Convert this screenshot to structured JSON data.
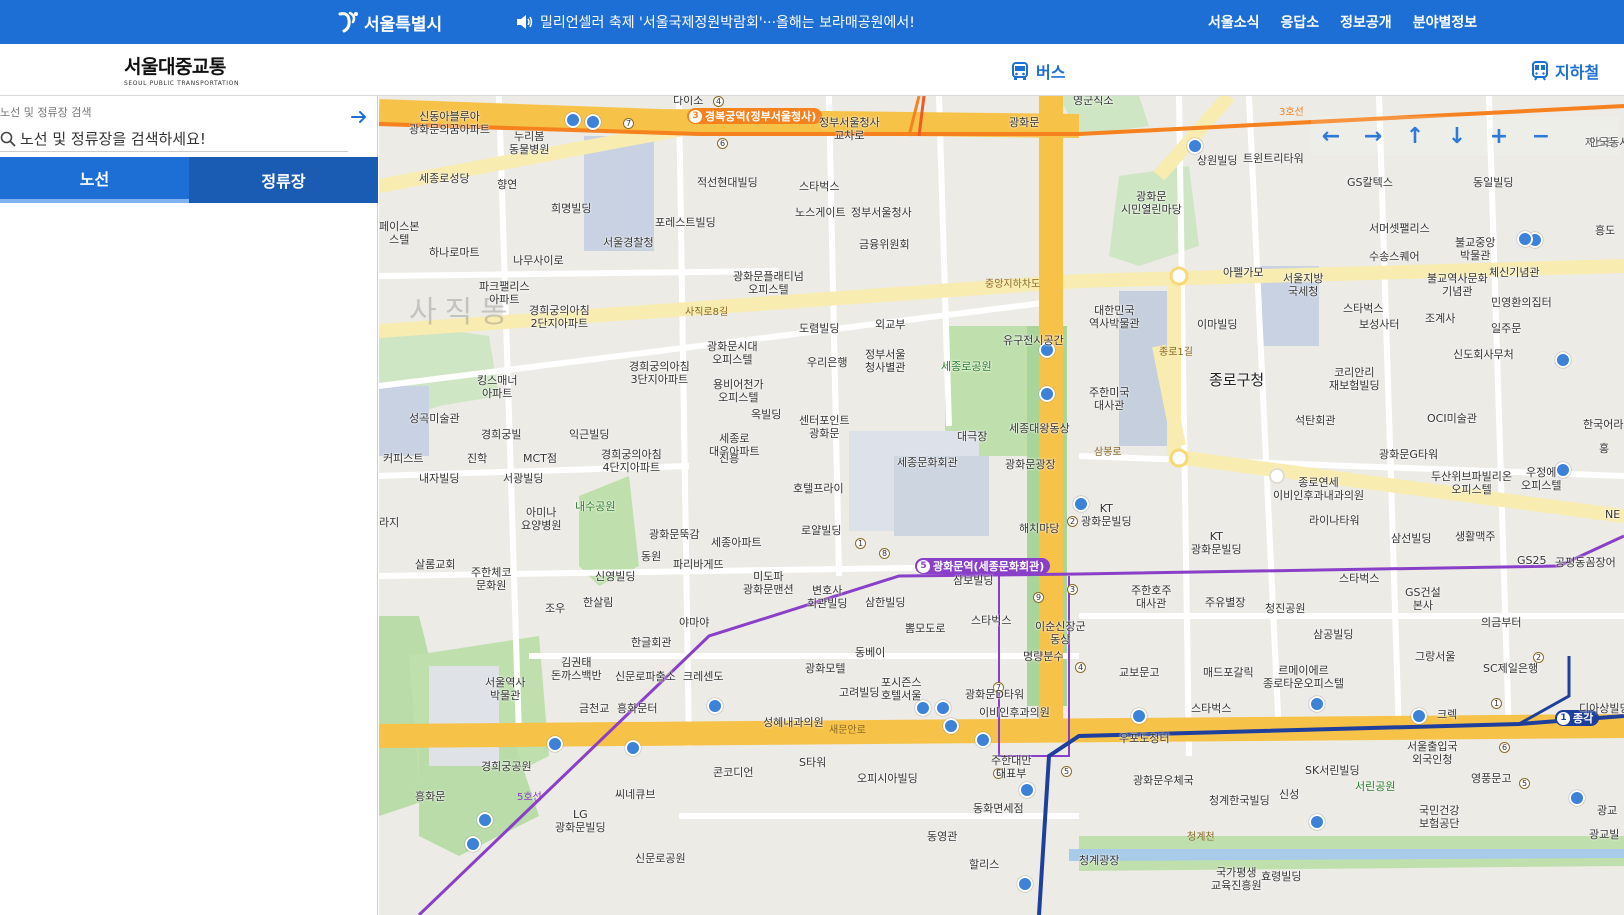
{
  "topbar": {
    "logo_text": "서울특별시",
    "notice": "밀리언셀러 축제 '서울국제정원박람회'···올해는 보라매공원에서!",
    "menu": [
      "서울소식",
      "응답소",
      "정보공개",
      "분야별정보"
    ],
    "bg_color": "#1d6fd6"
  },
  "header": {
    "brand_title": "서울대중교통",
    "brand_sub": "SEOUL PUBLIC TRANSPORTATION",
    "nav_bus": "버스",
    "nav_subway": "지하철"
  },
  "search": {
    "caption": "노선 및 정류장 검색",
    "placeholder": "노선 및 정류장을 검색하세요!"
  },
  "tabs": {
    "route": "노선",
    "stop": "정류장"
  },
  "map": {
    "district_label": "사직동",
    "major_label": "종로구청",
    "stations": {
      "gyeongbokgung": {
        "line": "3",
        "name": "경복궁역(정부서울청사)"
      },
      "gwanghwamun": {
        "line": "5",
        "name": "광화문역(세종문화회관)"
      },
      "jonggak": {
        "line": "1",
        "name": "종각"
      }
    },
    "road_labels": {
      "sajik8": "사직로8길",
      "jungang": "중앙지하차도",
      "saemunan": "새문안로",
      "sambong": "삼봉로",
      "jongno1": "종로1길",
      "cheonggye": "청계천",
      "line5": "5호선",
      "line3": "3호선"
    },
    "place_labels": [
      {
        "id": "p1",
        "text": "신동아블루아\n광화문의꿈아파트"
      },
      {
        "id": "p2",
        "text": "누리봄\n동물병원"
      },
      {
        "id": "p3",
        "text": "세종로성당"
      },
      {
        "id": "p4",
        "text": "향연"
      },
      {
        "id": "p5",
        "text": "희명빌딩"
      },
      {
        "id": "p6",
        "text": "서울경찰청"
      },
      {
        "id": "p7",
        "text": "적선현대빌딩"
      },
      {
        "id": "p8",
        "text": "스타벅스"
      },
      {
        "id": "p9",
        "text": "노스게이트"
      },
      {
        "id": "p10",
        "text": "포레스트빌딩"
      },
      {
        "id": "p11",
        "text": "정부서울청사"
      },
      {
        "id": "p12",
        "text": "금융위원회"
      },
      {
        "id": "p13",
        "text": "광화문플래티넘\n오피스텔"
      },
      {
        "id": "p14",
        "text": "하나로마트"
      },
      {
        "id": "p15",
        "text": "나무사이로"
      },
      {
        "id": "p16",
        "text": "페이스본\n스텔"
      },
      {
        "id": "p17",
        "text": "파크팰리스\n아파트"
      },
      {
        "id": "p18",
        "text": "경희궁의아침\n2단지아파트"
      },
      {
        "id": "p19",
        "text": "도렴빌딩"
      },
      {
        "id": "p20",
        "text": "외교부"
      },
      {
        "id": "p21",
        "text": "광화문시대\n오피스텔"
      },
      {
        "id": "p22",
        "text": "우리은행"
      },
      {
        "id": "p23",
        "text": "정부서울\n청사별관"
      },
      {
        "id": "p24",
        "text": "세종로공원"
      },
      {
        "id": "p25",
        "text": "유구전시공간"
      },
      {
        "id": "p26",
        "text": "경희궁의아침\n3단지아파트"
      },
      {
        "id": "p27",
        "text": "용비어천가\n오피스텔"
      },
      {
        "id": "p28",
        "text": "킹스매너\n아파트"
      },
      {
        "id": "p29",
        "text": "성곡미술관"
      },
      {
        "id": "p30",
        "text": "경희궁빌"
      },
      {
        "id": "p31",
        "text": "익근빌딩"
      },
      {
        "id": "p32",
        "text": "옥빌딩"
      },
      {
        "id": "p33",
        "text": "센터포인트\n광화문"
      },
      {
        "id": "p34",
        "text": "세종로\n대우아파트"
      },
      {
        "id": "p35",
        "text": "세종대왕동상"
      },
      {
        "id": "p36",
        "text": "대극장"
      },
      {
        "id": "p37",
        "text": "세종문화회관"
      },
      {
        "id": "p38",
        "text": "광화문광장"
      },
      {
        "id": "p39",
        "text": "경희궁의아침\n4단지아파트"
      },
      {
        "id": "p40",
        "text": "커피스트"
      },
      {
        "id": "p41",
        "text": "진학"
      },
      {
        "id": "p42",
        "text": "MCT점"
      },
      {
        "id": "p43",
        "text": "내자빌딩"
      },
      {
        "id": "p44",
        "text": "서광빌딩"
      },
      {
        "id": "p45",
        "text": "내수공원"
      },
      {
        "id": "p46",
        "text": "호텔프라이"
      },
      {
        "id": "p47",
        "text": "아미나\n요양병원"
      },
      {
        "id": "p48",
        "text": "로얄빌딩"
      },
      {
        "id": "p49",
        "text": "해치마당"
      },
      {
        "id": "p50",
        "text": "KT\n광화문빌딩"
      },
      {
        "id": "p51",
        "text": "광화문뚝감"
      },
      {
        "id": "p52",
        "text": "세종아파트"
      },
      {
        "id": "p53",
        "text": "동원"
      },
      {
        "id": "p54",
        "text": "파리바게뜨"
      },
      {
        "id": "p55",
        "text": "살롬교회"
      },
      {
        "id": "p56",
        "text": "주한체코\n문화원"
      },
      {
        "id": "p57",
        "text": "신영빌딩"
      },
      {
        "id": "p58",
        "text": "미도파\n광화문맨션"
      },
      {
        "id": "p59",
        "text": "변호사\n회관빌딩"
      },
      {
        "id": "p60",
        "text": "삼보빌딩"
      },
      {
        "id": "p61",
        "text": "주한호주\n대사관"
      },
      {
        "id": "p62",
        "text": "주유별장"
      },
      {
        "id": "p63",
        "text": "한살림"
      },
      {
        "id": "p64",
        "text": "조우"
      },
      {
        "id": "p65",
        "text": "야마야"
      },
      {
        "id": "p66",
        "text": "삼한빌딩"
      },
      {
        "id": "p67",
        "text": "뽐모도로"
      },
      {
        "id": "p68",
        "text": "스타벅스"
      },
      {
        "id": "p69",
        "text": "이순신장군\n동상"
      },
      {
        "id": "p70",
        "text": "명량분수"
      },
      {
        "id": "p71",
        "text": "한글회관"
      },
      {
        "id": "p72",
        "text": "김권태\n돈까스백반"
      },
      {
        "id": "p73",
        "text": "신문로파출소"
      },
      {
        "id": "p74",
        "text": "크레센도"
      },
      {
        "id": "p75",
        "text": "동베이"
      },
      {
        "id": "p76",
        "text": "광화모텔"
      },
      {
        "id": "p77",
        "text": "포시즌스\n호텔서울"
      },
      {
        "id": "p78",
        "text": "고려빌딩"
      },
      {
        "id": "p79",
        "text": "광화문D타워"
      },
      {
        "id": "p80",
        "text": "교보문고"
      },
      {
        "id": "p81",
        "text": "매드포갈릭"
      },
      {
        "id": "p82",
        "text": "서울역사\n박물관"
      },
      {
        "id": "p83",
        "text": "금천교"
      },
      {
        "id": "p84",
        "text": "흥화문터"
      },
      {
        "id": "p85",
        "text": "성혜내과의원"
      },
      {
        "id": "p86",
        "text": "이비인후과의원"
      },
      {
        "id": "p87",
        "text": "우포도청터"
      },
      {
        "id": "p88",
        "text": "경희궁공원"
      },
      {
        "id": "p89",
        "text": "흥화문"
      },
      {
        "id": "p90",
        "text": "콘코디언"
      },
      {
        "id": "p91",
        "text": "S타워"
      },
      {
        "id": "p92",
        "text": "오피시아빌딩"
      },
      {
        "id": "p93",
        "text": "주한대만\n대표부"
      },
      {
        "id": "p94",
        "text": "동화면세점"
      },
      {
        "id": "p95",
        "text": "씨네큐브"
      },
      {
        "id": "p96",
        "text": "LG\n광화문빌딩"
      },
      {
        "id": "p97",
        "text": "동영관"
      },
      {
        "id": "p98",
        "text": "신문로공원"
      },
      {
        "id": "p99",
        "text": "할리스"
      },
      {
        "id": "p100",
        "text": "광화문우체국"
      },
      {
        "id": "p101",
        "text": "청계한국빌딩"
      },
      {
        "id": "p102",
        "text": "신성"
      },
      {
        "id": "p103",
        "text": "청계광장"
      },
      {
        "id": "p104",
        "text": "국가평생\n교육진흥원"
      },
      {
        "id": "p105",
        "text": "효령빌딩"
      },
      {
        "id": "p106",
        "text": "광화문"
      },
      {
        "id": "p107",
        "text": "영군직소"
      },
      {
        "id": "p108",
        "text": "상원빌딩"
      },
      {
        "id": "p109",
        "text": "트윈트리타워"
      },
      {
        "id": "p110",
        "text": "광화문\n시민열린마당"
      },
      {
        "id": "p111",
        "text": "GS칼텍스"
      },
      {
        "id": "p112",
        "text": "동일빌딩"
      },
      {
        "id": "p113",
        "text": "서머셋팰리스"
      },
      {
        "id": "p114",
        "text": "불교중앙\n박물관"
      },
      {
        "id": "p115",
        "text": "수송스퀘어"
      },
      {
        "id": "p116",
        "text": "체신기념관"
      },
      {
        "id": "p117",
        "text": "아펠가모"
      },
      {
        "id": "p118",
        "text": "서울지방\n국세청"
      },
      {
        "id": "p119",
        "text": "불교역사문화\n기념관"
      },
      {
        "id": "p120",
        "text": "민영환의집터"
      },
      {
        "id": "p121",
        "text": "스타벅스"
      },
      {
        "id": "p122",
        "text": "보성사터"
      },
      {
        "id": "p123",
        "text": "조계사"
      },
      {
        "id": "p124",
        "text": "일주문"
      },
      {
        "id": "p125",
        "text": "대한민국\n역사박물관"
      },
      {
        "id": "p126",
        "text": "이마빌딩"
      },
      {
        "id": "p127",
        "text": "신도회사무처"
      },
      {
        "id": "p128",
        "text": "코리안리\n재보험빌딩"
      },
      {
        "id": "p129",
        "text": "주한미국\n대사관"
      },
      {
        "id": "p130",
        "text": "석탄회관"
      },
      {
        "id": "p131",
        "text": "OCI미술관"
      },
      {
        "id": "p132",
        "text": "광화문G타워"
      },
      {
        "id": "p133",
        "text": "종로연세\n이비인후과내과의원"
      },
      {
        "id": "p134",
        "text": "두산위브파빌리온\n오피스텔"
      },
      {
        "id": "p135",
        "text": "우정에\n오피스텔"
      },
      {
        "id": "p136",
        "text": "라이나타워"
      },
      {
        "id": "p137",
        "text": "삼선빌딩"
      },
      {
        "id": "p138",
        "text": "생활맥주"
      },
      {
        "id": "p139",
        "text": "KT\n광화문빌딩"
      },
      {
        "id": "p140",
        "text": "GS25"
      },
      {
        "id": "p141",
        "text": "공평동꼼장어"
      },
      {
        "id": "p142",
        "text": "스타벅스"
      },
      {
        "id": "p143",
        "text": "청진공원"
      },
      {
        "id": "p144",
        "text": "GS건설\n본사"
      },
      {
        "id": "p145",
        "text": "삼공빌딩"
      },
      {
        "id": "p146",
        "text": "의금부터"
      },
      {
        "id": "p147",
        "text": "그랑서울"
      },
      {
        "id": "p148",
        "text": "SC제일은행"
      },
      {
        "id": "p149",
        "text": "르메이에르\n종로타운오피스텔"
      },
      {
        "id": "p150",
        "text": "스타벅스"
      },
      {
        "id": "p151",
        "text": "크렉"
      },
      {
        "id": "p152",
        "text": "서울출입국\n외국인청"
      },
      {
        "id": "p153",
        "text": "SK서린빌딩"
      },
      {
        "id": "p154",
        "text": "서린공원"
      },
      {
        "id": "p155",
        "text": "영풍문고"
      },
      {
        "id": "p156",
        "text": "국민건강\n보험공단"
      },
      {
        "id": "p157",
        "text": "광교빌"
      },
      {
        "id": "p158",
        "text": "진흥"
      },
      {
        "id": "p159",
        "text": "다이소"
      },
      {
        "id": "p160",
        "text": "정부서울청사\n교차로"
      },
      {
        "id": "p161",
        "text": "제스트"
      },
      {
        "id": "p162",
        "text": "라지"
      },
      {
        "id": "p163",
        "text": "흥도"
      },
      {
        "id": "p164",
        "text": "디아상빌딩"
      },
      {
        "id": "p165",
        "text": "한국어라이"
      },
      {
        "id": "p166",
        "text": "광교"
      },
      {
        "id": "p167",
        "text": "안국동사거리"
      },
      {
        "id": "p168",
        "text": "홍"
      },
      {
        "id": "p169",
        "text": "NE"
      }
    ]
  },
  "map_controls": [
    "left-arrow",
    "right-arrow",
    "up-arrow",
    "down-arrow",
    "zoom-in",
    "zoom-out"
  ]
}
